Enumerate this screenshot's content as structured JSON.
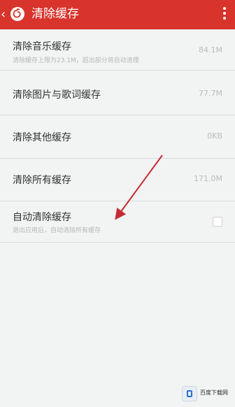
{
  "header": {
    "title": "清除缓存"
  },
  "items": [
    {
      "title": "清除音乐缓存",
      "subtitle": "清除缓存上限为23.1M，超出部分将自动清理",
      "value": "84.1M"
    },
    {
      "title": "清除图片与歌词缓存",
      "value": "77.7M"
    },
    {
      "title": "清除其他缓存",
      "value": "0KB"
    },
    {
      "title": "清除所有缓存",
      "value": "171.0M"
    },
    {
      "title": "自动清除缓存",
      "subtitle": "退出应用后，自动清除所有缓存",
      "checked": false
    }
  ],
  "watermark": {
    "text": "百度下载网"
  },
  "colors": {
    "header_bg": "#d8342c",
    "page_bg": "#f2f3f3",
    "annotation_arrow": "#c62c35"
  }
}
